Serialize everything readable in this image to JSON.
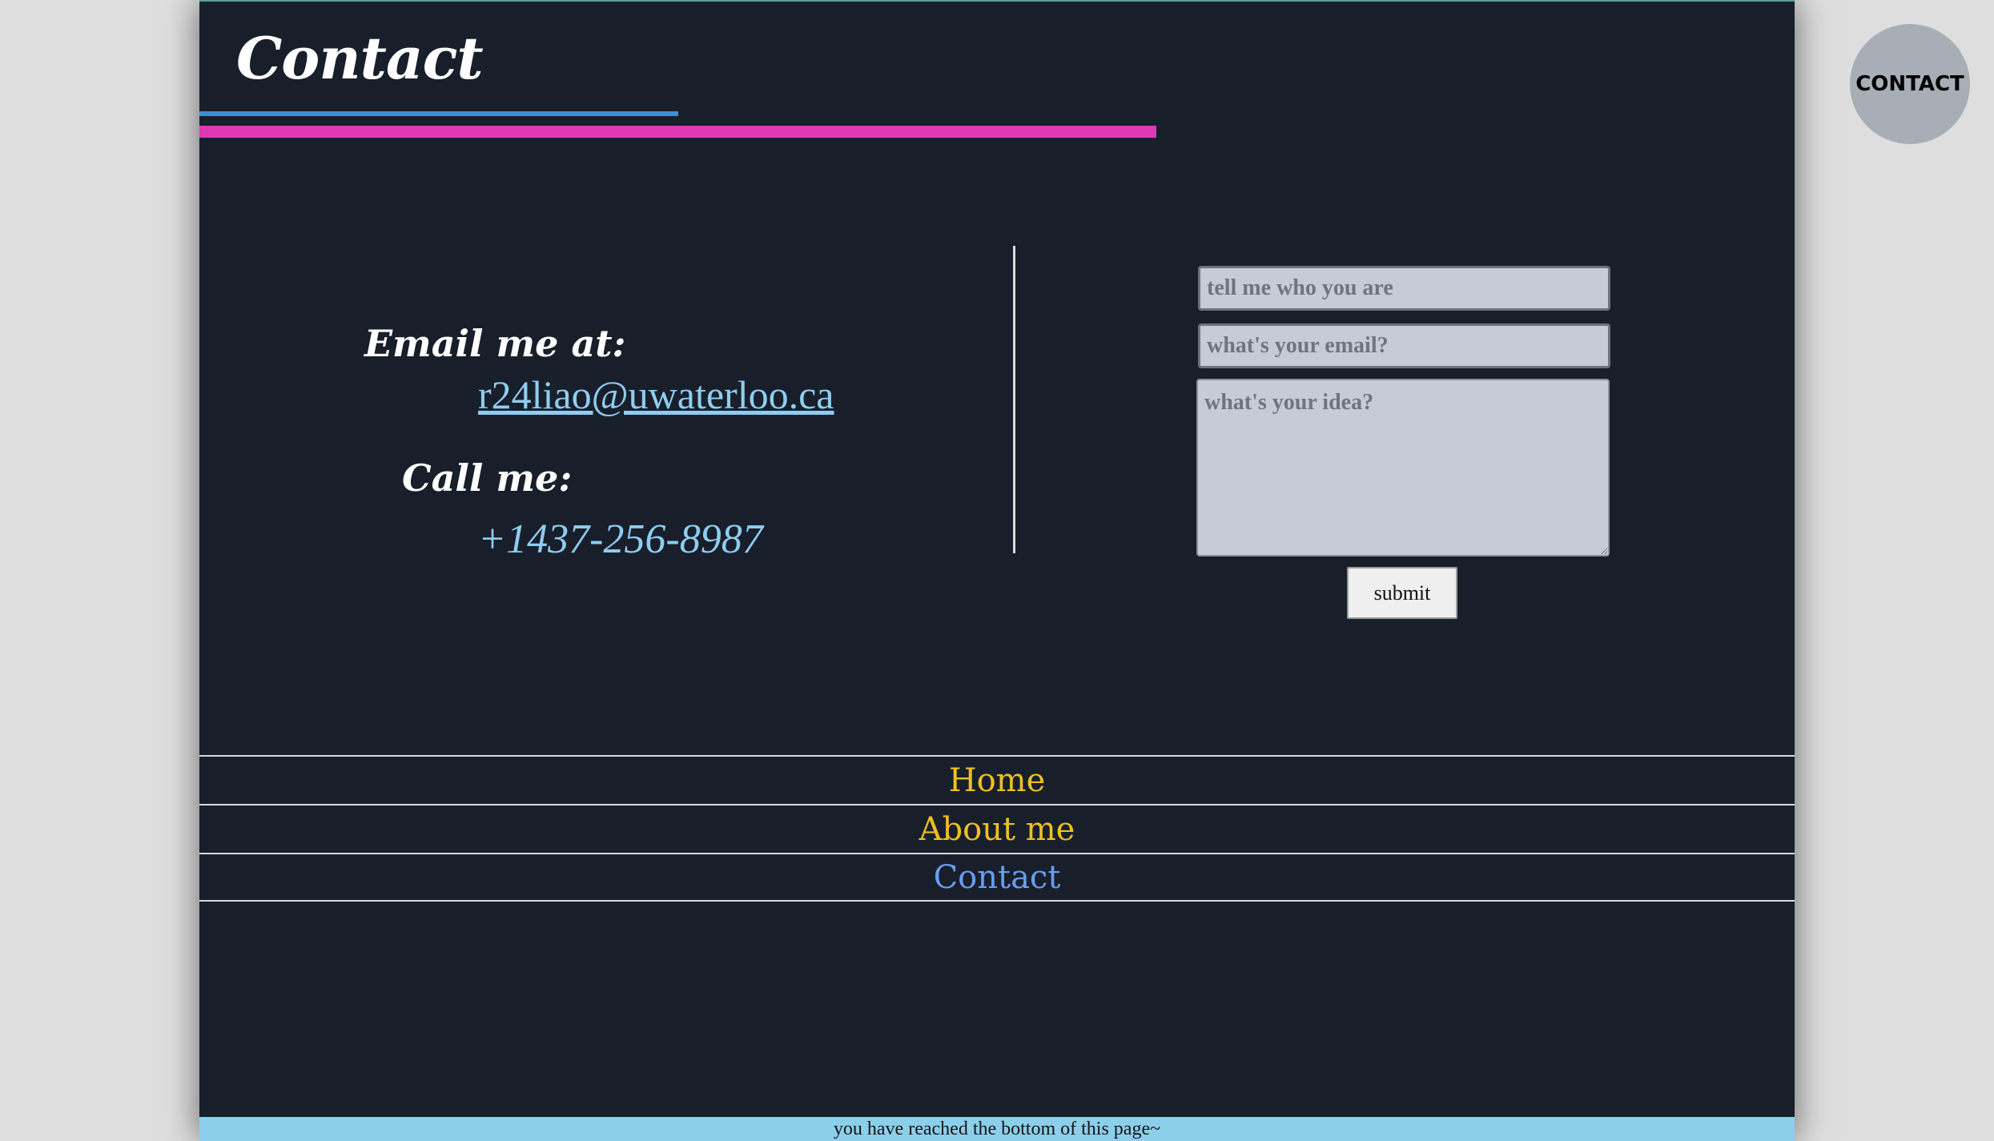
{
  "header": {
    "title": "Contact"
  },
  "contact_info": {
    "email_label": "Email me at:",
    "email": "r24liao@uwaterloo.ca",
    "call_label": "Call me:",
    "phone": "+1437-256-8987"
  },
  "form": {
    "name_placeholder": "tell me who you are",
    "email_placeholder": "what's your email?",
    "idea_placeholder": "what's your idea?",
    "submit_label": "submit"
  },
  "nav": {
    "items": [
      {
        "label": "Home"
      },
      {
        "label": "About me"
      },
      {
        "label": "Contact"
      }
    ]
  },
  "footer": {
    "text": "you have reached the bottom of  this page~"
  },
  "fab": {
    "label": "CONTACT"
  },
  "colors": {
    "background": "#181f2b",
    "accent_blue": "#3b8ed6",
    "accent_pink": "#e037b3",
    "link": "#8ecdf0",
    "nav_text": "#f0c020",
    "nav_active": "#6b9cf0",
    "footer_bg": "#8ccfeb"
  }
}
